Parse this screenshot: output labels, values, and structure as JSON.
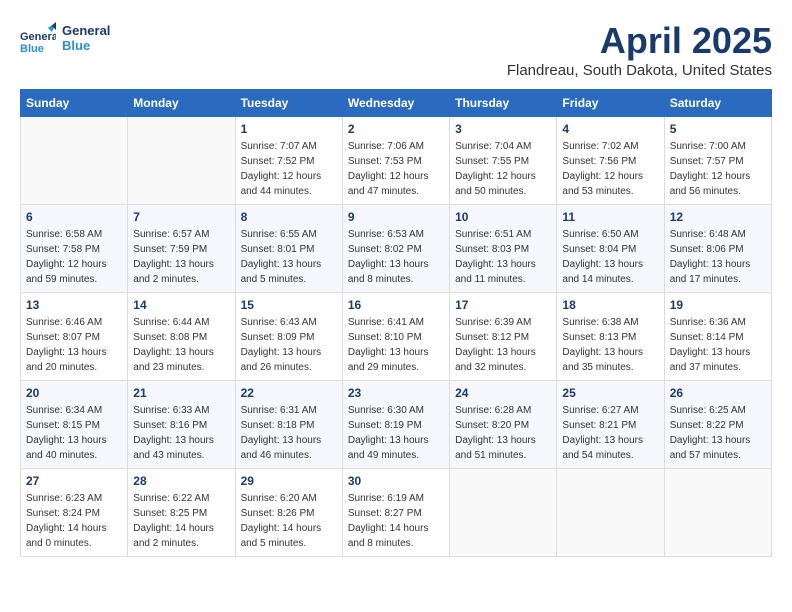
{
  "header": {
    "logo_line1": "General",
    "logo_line2": "Blue",
    "month_title": "April 2025",
    "location": "Flandreau, South Dakota, United States"
  },
  "weekdays": [
    "Sunday",
    "Monday",
    "Tuesday",
    "Wednesday",
    "Thursday",
    "Friday",
    "Saturday"
  ],
  "weeks": [
    [
      {
        "day": "",
        "detail": ""
      },
      {
        "day": "",
        "detail": ""
      },
      {
        "day": "1",
        "detail": "Sunrise: 7:07 AM\nSunset: 7:52 PM\nDaylight: 12 hours and 44 minutes."
      },
      {
        "day": "2",
        "detail": "Sunrise: 7:06 AM\nSunset: 7:53 PM\nDaylight: 12 hours and 47 minutes."
      },
      {
        "day": "3",
        "detail": "Sunrise: 7:04 AM\nSunset: 7:55 PM\nDaylight: 12 hours and 50 minutes."
      },
      {
        "day": "4",
        "detail": "Sunrise: 7:02 AM\nSunset: 7:56 PM\nDaylight: 12 hours and 53 minutes."
      },
      {
        "day": "5",
        "detail": "Sunrise: 7:00 AM\nSunset: 7:57 PM\nDaylight: 12 hours and 56 minutes."
      }
    ],
    [
      {
        "day": "6",
        "detail": "Sunrise: 6:58 AM\nSunset: 7:58 PM\nDaylight: 12 hours and 59 minutes."
      },
      {
        "day": "7",
        "detail": "Sunrise: 6:57 AM\nSunset: 7:59 PM\nDaylight: 13 hours and 2 minutes."
      },
      {
        "day": "8",
        "detail": "Sunrise: 6:55 AM\nSunset: 8:01 PM\nDaylight: 13 hours and 5 minutes."
      },
      {
        "day": "9",
        "detail": "Sunrise: 6:53 AM\nSunset: 8:02 PM\nDaylight: 13 hours and 8 minutes."
      },
      {
        "day": "10",
        "detail": "Sunrise: 6:51 AM\nSunset: 8:03 PM\nDaylight: 13 hours and 11 minutes."
      },
      {
        "day": "11",
        "detail": "Sunrise: 6:50 AM\nSunset: 8:04 PM\nDaylight: 13 hours and 14 minutes."
      },
      {
        "day": "12",
        "detail": "Sunrise: 6:48 AM\nSunset: 8:06 PM\nDaylight: 13 hours and 17 minutes."
      }
    ],
    [
      {
        "day": "13",
        "detail": "Sunrise: 6:46 AM\nSunset: 8:07 PM\nDaylight: 13 hours and 20 minutes."
      },
      {
        "day": "14",
        "detail": "Sunrise: 6:44 AM\nSunset: 8:08 PM\nDaylight: 13 hours and 23 minutes."
      },
      {
        "day": "15",
        "detail": "Sunrise: 6:43 AM\nSunset: 8:09 PM\nDaylight: 13 hours and 26 minutes."
      },
      {
        "day": "16",
        "detail": "Sunrise: 6:41 AM\nSunset: 8:10 PM\nDaylight: 13 hours and 29 minutes."
      },
      {
        "day": "17",
        "detail": "Sunrise: 6:39 AM\nSunset: 8:12 PM\nDaylight: 13 hours and 32 minutes."
      },
      {
        "day": "18",
        "detail": "Sunrise: 6:38 AM\nSunset: 8:13 PM\nDaylight: 13 hours and 35 minutes."
      },
      {
        "day": "19",
        "detail": "Sunrise: 6:36 AM\nSunset: 8:14 PM\nDaylight: 13 hours and 37 minutes."
      }
    ],
    [
      {
        "day": "20",
        "detail": "Sunrise: 6:34 AM\nSunset: 8:15 PM\nDaylight: 13 hours and 40 minutes."
      },
      {
        "day": "21",
        "detail": "Sunrise: 6:33 AM\nSunset: 8:16 PM\nDaylight: 13 hours and 43 minutes."
      },
      {
        "day": "22",
        "detail": "Sunrise: 6:31 AM\nSunset: 8:18 PM\nDaylight: 13 hours and 46 minutes."
      },
      {
        "day": "23",
        "detail": "Sunrise: 6:30 AM\nSunset: 8:19 PM\nDaylight: 13 hours and 49 minutes."
      },
      {
        "day": "24",
        "detail": "Sunrise: 6:28 AM\nSunset: 8:20 PM\nDaylight: 13 hours and 51 minutes."
      },
      {
        "day": "25",
        "detail": "Sunrise: 6:27 AM\nSunset: 8:21 PM\nDaylight: 13 hours and 54 minutes."
      },
      {
        "day": "26",
        "detail": "Sunrise: 6:25 AM\nSunset: 8:22 PM\nDaylight: 13 hours and 57 minutes."
      }
    ],
    [
      {
        "day": "27",
        "detail": "Sunrise: 6:23 AM\nSunset: 8:24 PM\nDaylight: 14 hours and 0 minutes."
      },
      {
        "day": "28",
        "detail": "Sunrise: 6:22 AM\nSunset: 8:25 PM\nDaylight: 14 hours and 2 minutes."
      },
      {
        "day": "29",
        "detail": "Sunrise: 6:20 AM\nSunset: 8:26 PM\nDaylight: 14 hours and 5 minutes."
      },
      {
        "day": "30",
        "detail": "Sunrise: 6:19 AM\nSunset: 8:27 PM\nDaylight: 14 hours and 8 minutes."
      },
      {
        "day": "",
        "detail": ""
      },
      {
        "day": "",
        "detail": ""
      },
      {
        "day": "",
        "detail": ""
      }
    ]
  ]
}
